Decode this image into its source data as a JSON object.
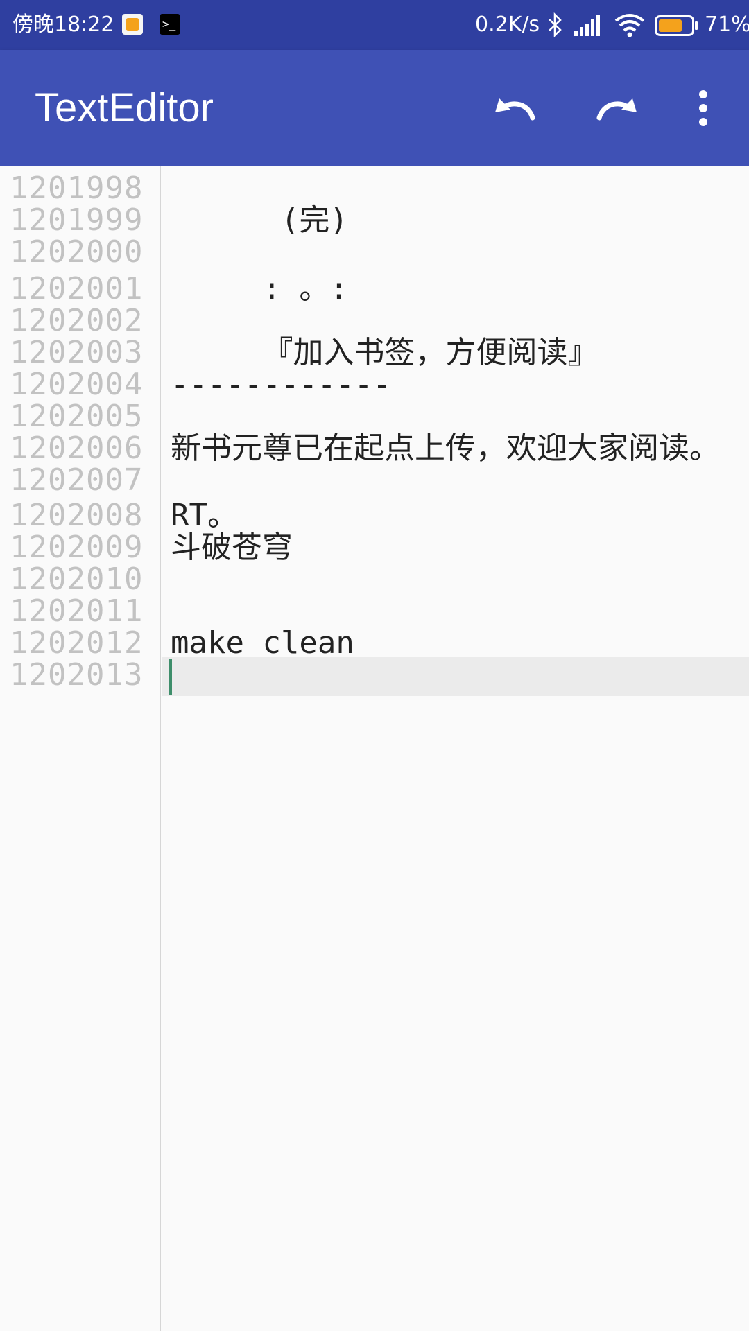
{
  "status_bar": {
    "time": "傍晚18:22",
    "network_speed": "0.2K/s",
    "battery_percent": "71%",
    "battery_level": 0.71,
    "icons": [
      "app-notification-icon",
      "terminal-icon",
      "bluetooth-icon",
      "signal-icon",
      "wifi-icon",
      "battery-icon"
    ],
    "terminal_glyph": ">_"
  },
  "toolbar": {
    "title": "TextEditor",
    "actions": [
      "undo-icon",
      "redo-icon",
      "more-vert-icon"
    ]
  },
  "colors": {
    "status_bar_bg": "#2f3fa0",
    "app_bar_bg": "#3f51b5",
    "cursor": "#3e8e6b",
    "battery_fill": "#f4a21c"
  },
  "editor": {
    "line_numbers": [
      "1201998",
      "1201999",
      "1202000",
      "1202001",
      "1202002",
      "1202003",
      "1202004",
      "1202005",
      "1202006",
      "1202007",
      "1202008",
      "1202009",
      "1202010",
      "1202011",
      "1202012",
      "1202013"
    ],
    "lines": [
      "",
      "      (完)",
      "",
      "     : 。:",
      "",
      "     『加入书签，方便阅读』",
      "------------",
      "",
      "新书元尊已在起点上传，欢迎大家阅读。",
      "",
      "RT。",
      "斗破苍穹",
      "",
      "",
      "make clean",
      ""
    ],
    "current_line": "1202013"
  }
}
